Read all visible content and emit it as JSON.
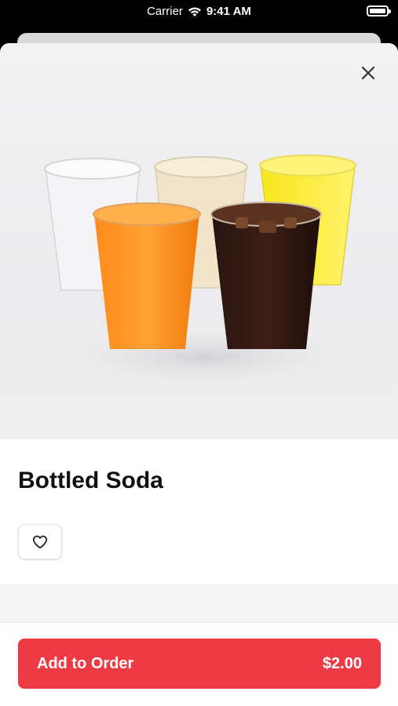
{
  "status_bar": {
    "carrier": "Carrier",
    "time": "9:41 AM"
  },
  "product": {
    "name": "Bottled Soda",
    "image_alt": "cups-of-soda-image"
  },
  "footer": {
    "add_label": "Add to Order",
    "price": "$2.00"
  },
  "colors": {
    "accent": "#ee3a45"
  },
  "icons": [
    "wifi-icon",
    "battery-icon",
    "close-icon",
    "heart-icon"
  ]
}
